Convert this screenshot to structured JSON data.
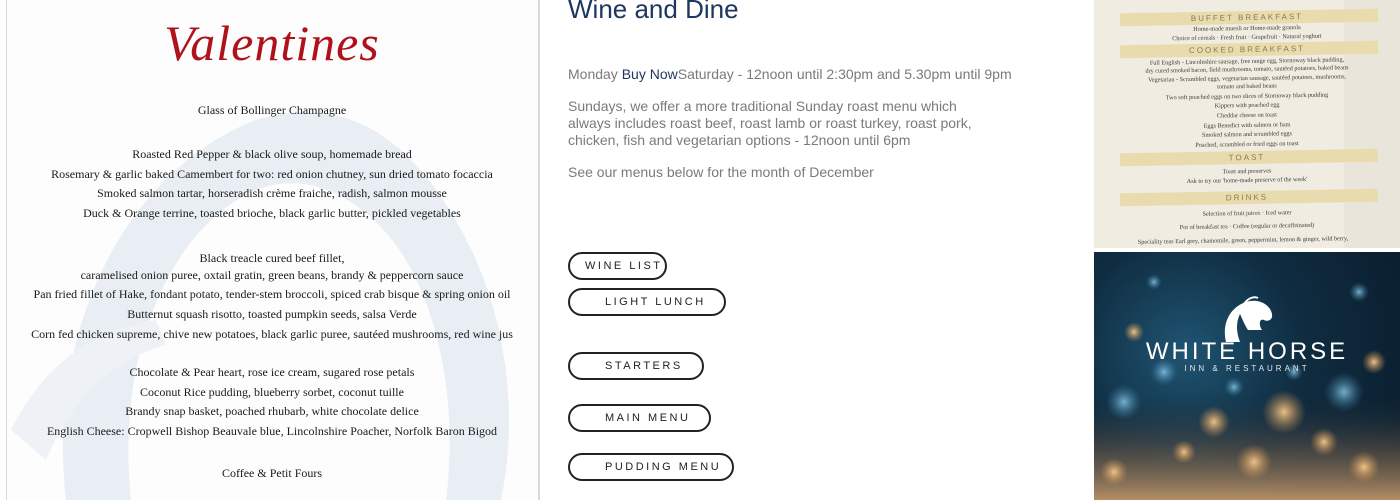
{
  "menu_card": {
    "title": "Valentines",
    "lines": [
      "Glass of Bollinger Champagne",
      "Roasted Red Pepper & black olive soup, homemade bread",
      "Rosemary & garlic baked Camembert for two: red onion chutney, sun dried tomato focaccia",
      "Smoked salmon tartar, horseradish crème fraiche, radish, salmon mousse",
      "Duck & Orange terrine, toasted brioche, black garlic butter, pickled vegetables",
      "Black treacle cured beef fillet,",
      "caramelised onion puree, oxtail gratin, green beans, brandy & peppercorn sauce",
      "Pan fried fillet of Hake, fondant potato, tender-stem broccoli, spiced crab bisque & spring onion oil",
      "Butternut squash risotto, toasted pumpkin seeds, salsa Verde",
      "Corn fed chicken supreme, chive new potatoes, black garlic puree, sautéed mushrooms, red wine jus",
      "Chocolate & Pear heart, rose ice cream, sugared rose petals",
      "Coconut Rice pudding, blueberry sorbet, coconut tuille",
      "Brandy snap basket, poached rhubarb, white chocolate delice",
      "English Cheese: Cropwell Bishop Beauvale blue, Lincolnshire Poacher, Norfolk Baron Bigod",
      "Coffee & Petit Fours"
    ],
    "watermark_color": "#e9eef4"
  },
  "content": {
    "title": "Wine and Dine",
    "hours_prefix": "Monday ",
    "buy_now": "Buy Now",
    "hours_suffix": "Saturday - 12noon until 2:30pm and 5.30pm until 9pm",
    "sunday_text": "Sundays, we offer a more traditional Sunday roast menu which always includes roast beef, roast lamb or roast turkey, roast pork, chicken, fish and vegetarian options - 12noon until 6pm",
    "december_text": "See our menus below for the month of December",
    "buttons": [
      {
        "label": "WINE LIST"
      },
      {
        "label": "LIGHT LUNCH"
      },
      {
        "label": "STARTERS"
      },
      {
        "label": "MAIN MENU"
      },
      {
        "label": "PUDDING MENU"
      }
    ],
    "colors": {
      "title": "#1f3760",
      "body": "#7a7a7a",
      "link": "#1f3760"
    }
  },
  "breakfast_photo": {
    "sections": [
      {
        "heading": "BUFFET BREAKFAST",
        "items": [
          "Home-made muesli or Home-made granola",
          "Choice of cereals · Fresh fruit · Grapefruit · Natural yoghurt"
        ]
      },
      {
        "heading": "COOKED BREAKFAST",
        "items": [
          "Full English - Lincolnshire sausage, free range egg, Stornoway black pudding,",
          "dry cured smoked bacon, field mushrooms, tomato, sautéed potatoes, baked beans",
          "Vegetarian - Scrambled eggs, vegetarian sausage, sautéed potatoes, mushrooms,",
          "tomato and baked beans",
          "Two soft poached eggs on two slices of Stornoway black pudding",
          "Kippers with poached egg",
          "Cheddar cheese on toast",
          "Eggs Benedict with salmon or ham",
          "Smoked salmon and scrambled eggs",
          "Poached, scrambled or fried eggs on toast"
        ]
      },
      {
        "heading": "TOAST",
        "items": [
          "Toast and preserves",
          "Ask to try our 'home-made preserve of the week'"
        ]
      },
      {
        "heading": "DRINKS",
        "items": [
          "Selection of fruit juices · Iced water",
          "Pot of breakfast tea · Coffee (regular or decaffeinated)",
          "Speciality teas Earl grey, chamomile, green, peppermint, lemon & ginger, wild berry,"
        ]
      }
    ]
  },
  "logo_photo": {
    "brand_name": "WHITE HORSE",
    "brand_sub": "INN & RESTAURANT",
    "icon": "horse-head-icon"
  }
}
